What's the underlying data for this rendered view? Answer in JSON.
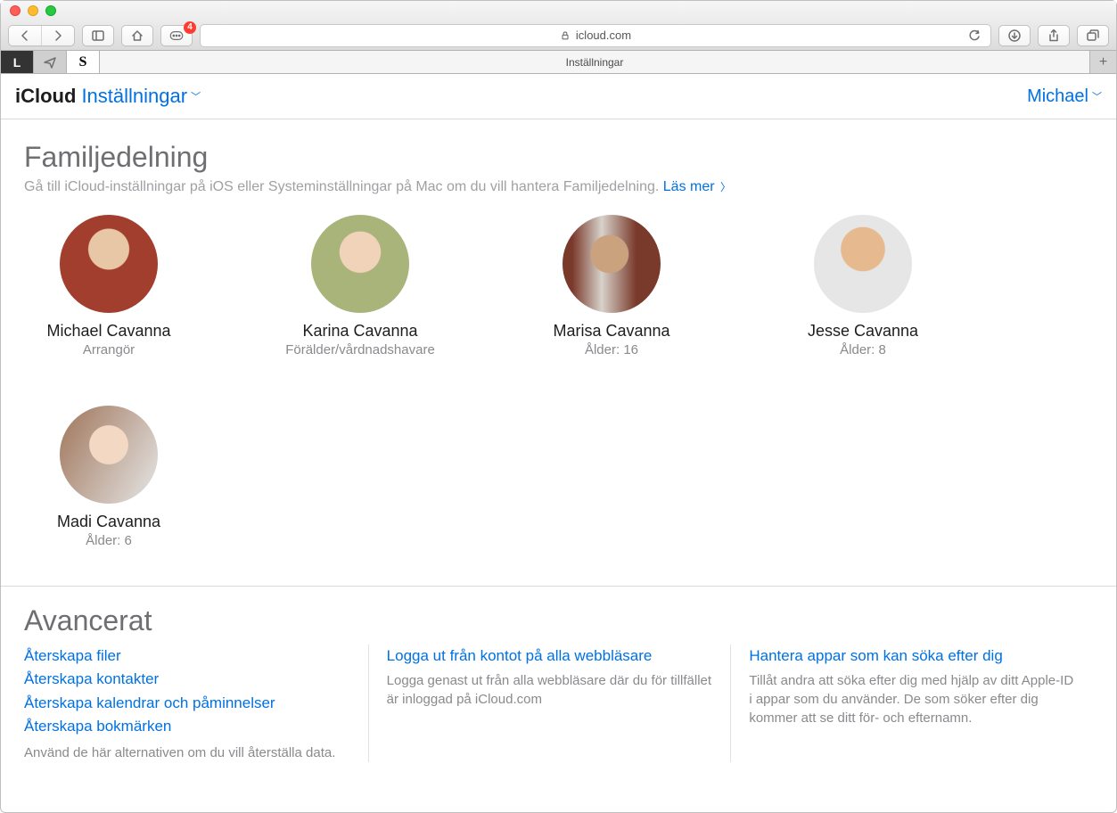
{
  "browser": {
    "badge_count": "4",
    "address_host": "icloud.com",
    "active_tab_title": "Inställningar"
  },
  "header": {
    "brand": "iCloud",
    "crumb": "Inställningar",
    "user": "Michael"
  },
  "family": {
    "title": "Familjedelning",
    "subtitle_text": "Gå till iCloud-inställningar på iOS eller Systeminställningar på Mac om du vill hantera Familjedelning. ",
    "learn_more": "Läs mer",
    "members": [
      {
        "name": "Michael Cavanna",
        "role": "Arrangör"
      },
      {
        "name": "Karina Cavanna",
        "role": "Förälder/vårdnadshavare"
      },
      {
        "name": "Marisa Cavanna",
        "role": "Ålder: 16"
      },
      {
        "name": "Jesse Cavanna",
        "role": "Ålder: 8"
      },
      {
        "name": "Madi Cavanna",
        "role": "Ålder: 6"
      }
    ]
  },
  "advanced": {
    "title": "Avancerat",
    "col1": {
      "links": [
        "Återskapa filer",
        "Återskapa kontakter",
        "Återskapa kalendrar och påminnelser",
        "Återskapa bokmärken"
      ],
      "desc": "Använd de här alternativen om du vill återställa data."
    },
    "col2": {
      "link": "Logga ut från kontot på alla webbläsare",
      "desc": "Logga genast ut från alla webbläsare där du för tillfället är inloggad på iCloud.com"
    },
    "col3": {
      "link": "Hantera appar som kan söka efter dig",
      "desc": "Tillåt andra att söka efter dig med hjälp av ditt Apple-ID i appar som du använder. De som söker efter dig kommer att se ditt för- och efternamn."
    }
  }
}
